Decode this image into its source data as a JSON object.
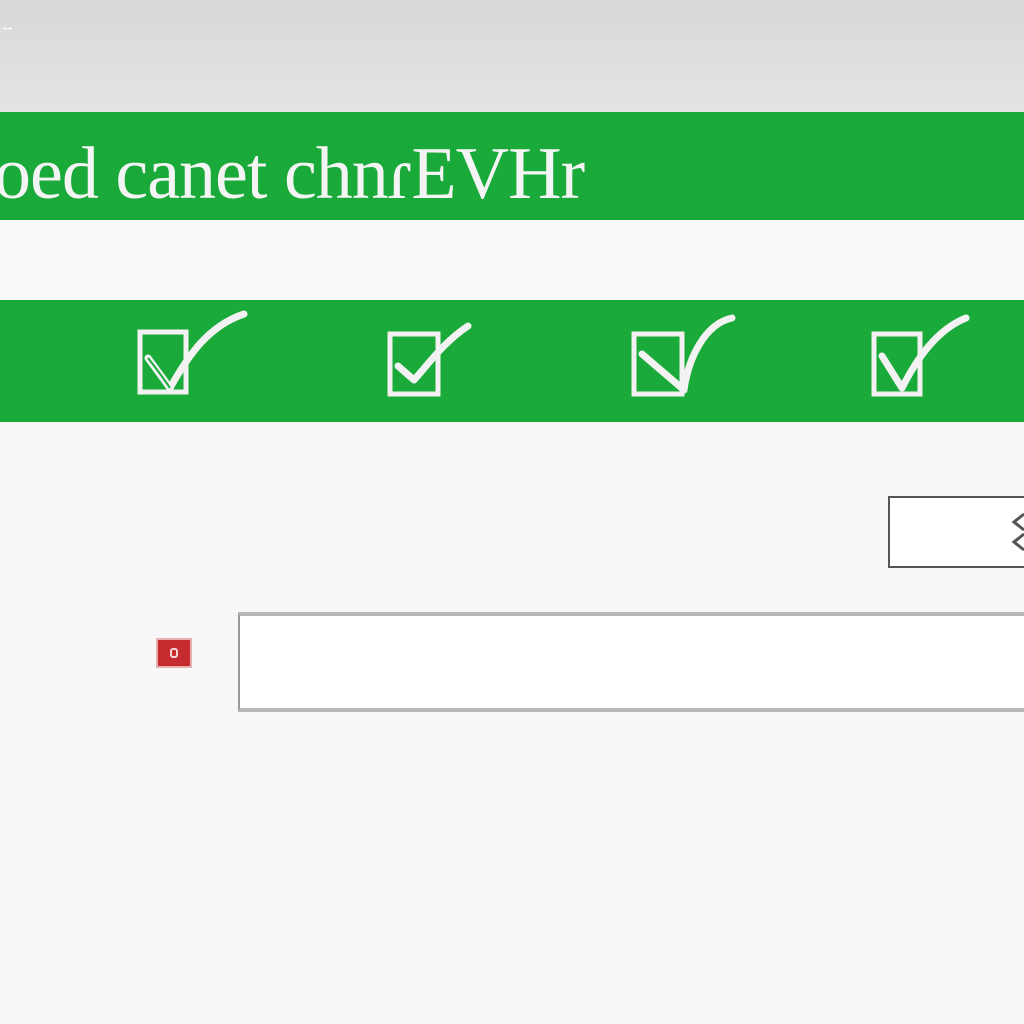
{
  "window": {
    "corner_label": "↔"
  },
  "header": {
    "title": "oed canet chnɾEVHr"
  },
  "checks": [
    {
      "name": "check-item-1",
      "checked": true
    },
    {
      "name": "check-item-2",
      "checked": true
    },
    {
      "name": "check-item-3",
      "checked": true
    },
    {
      "name": "check-item-4",
      "checked": true
    }
  ],
  "form": {
    "input_value": "",
    "input_placeholder": ""
  },
  "colors": {
    "accent_green": "#1aaa3a",
    "marker_red": "#c62b30",
    "topbar_gray": "#dcdcdc"
  },
  "icons": {
    "check": "checkbox-checked-icon",
    "marker": "error-marker-icon"
  }
}
